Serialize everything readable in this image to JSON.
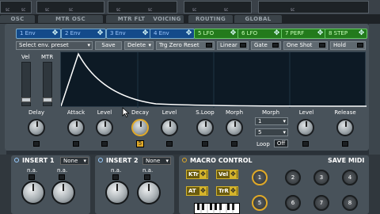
{
  "top_slots": [
    {
      "sc": "SC"
    },
    {
      "sc": "SC"
    },
    {
      "sc": "SC"
    },
    {
      "sc": "SC"
    },
    {
      "sc": "SC"
    },
    {
      "sc": "SC"
    },
    {
      "sc": "SC"
    },
    {
      "sc": "SC"
    },
    {
      "sc": "SC"
    }
  ],
  "section_tabs": [
    "OSC",
    "MTR OSC",
    "MTR FLT",
    "VOICING",
    "ROUTING",
    "GLOBAL"
  ],
  "env_tabs": [
    {
      "label": "1 Env",
      "color": "blue"
    },
    {
      "label": "2 Env",
      "color": "blue"
    },
    {
      "label": "3 Env",
      "color": "blue"
    },
    {
      "label": "4 Env",
      "color": "blue"
    },
    {
      "label": "5 LFO",
      "color": "green"
    },
    {
      "label": "6 LFO",
      "color": "green"
    },
    {
      "label": "7 PERF",
      "color": "green"
    },
    {
      "label": "8 STEP",
      "color": "green"
    }
  ],
  "toolbar": {
    "preset_select": "Select env. preset",
    "save": "Save",
    "delete": "Delete",
    "trg_zero_reset": "Trg Zero Reset",
    "linear": "Linear",
    "gate": "Gate",
    "one_shot": "One Shot",
    "hold": "Hold"
  },
  "side_sliders": {
    "vel": "Vel",
    "mtr": "MTR"
  },
  "env_knobs": [
    "Delay",
    "Attack",
    "Level",
    "Decay",
    "Level",
    "S.Loop",
    "Morph",
    "Morph",
    "Level",
    "Release"
  ],
  "decay_value": "5",
  "morph": {
    "select1": "1",
    "select2": "5",
    "loop_label": "Loop",
    "loop_value": "Off"
  },
  "insert1": {
    "title": "INSERT 1",
    "select": "None",
    "knob1": "n.a.",
    "knob2": "n.a."
  },
  "insert2": {
    "title": "INSERT 2",
    "select": "None",
    "knob1": "n.a.",
    "knob2": "n.a."
  },
  "macro": {
    "title": "MACRO CONTROL",
    "save_midi": "SAVE MIDI",
    "buttons": [
      "KTr",
      "Vel",
      "AT",
      "TrR"
    ],
    "knobs": [
      "1",
      "2",
      "3",
      "4",
      "5",
      "6",
      "7",
      "8"
    ]
  },
  "colors": {
    "env_blue": "#134a8a",
    "lfo_green": "#237a1c",
    "accent_orange": "#e0a928",
    "graph_bg": "#0d1a25"
  }
}
